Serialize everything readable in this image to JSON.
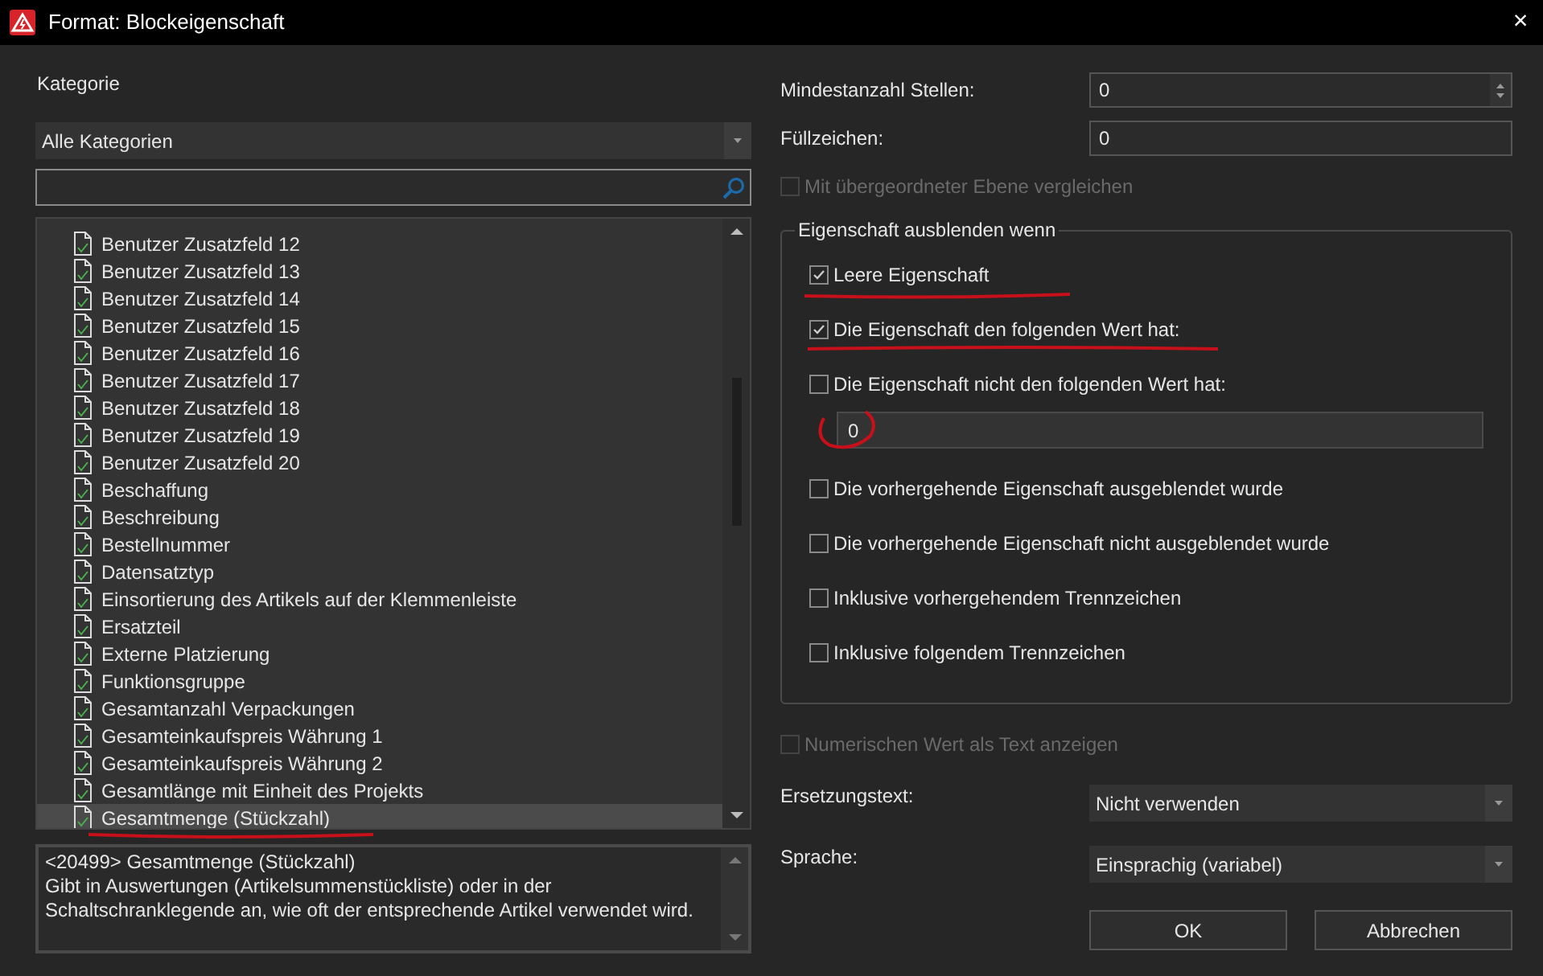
{
  "window": {
    "title": "Format: Blockeigenschaft",
    "close": "×"
  },
  "category": {
    "label": "Kategorie",
    "dropdown": "Alle Kategorien"
  },
  "properties": [
    {
      "label": "Benutzer Zusatzfeld 12",
      "selected": false
    },
    {
      "label": "Benutzer Zusatzfeld 13",
      "selected": false
    },
    {
      "label": "Benutzer Zusatzfeld 14",
      "selected": false
    },
    {
      "label": "Benutzer Zusatzfeld 15",
      "selected": false
    },
    {
      "label": "Benutzer Zusatzfeld 16",
      "selected": false
    },
    {
      "label": "Benutzer Zusatzfeld 17",
      "selected": false
    },
    {
      "label": "Benutzer Zusatzfeld 18",
      "selected": false
    },
    {
      "label": "Benutzer Zusatzfeld 19",
      "selected": false
    },
    {
      "label": "Benutzer Zusatzfeld 20",
      "selected": false
    },
    {
      "label": "Beschaffung",
      "selected": false
    },
    {
      "label": "Beschreibung",
      "selected": false
    },
    {
      "label": "Bestellnummer",
      "selected": false
    },
    {
      "label": "Datensatztyp",
      "selected": false
    },
    {
      "label": "Einsortierung des Artikels auf der Klemmenleiste",
      "selected": false
    },
    {
      "label": "Ersatzteil",
      "selected": false
    },
    {
      "label": "Externe Platzierung",
      "selected": false
    },
    {
      "label": "Funktionsgruppe",
      "selected": false
    },
    {
      "label": "Gesamtanzahl Verpackungen",
      "selected": false
    },
    {
      "label": "Gesamteinkaufspreis Währung 1",
      "selected": false
    },
    {
      "label": "Gesamteinkaufspreis Währung 2",
      "selected": false
    },
    {
      "label": "Gesamtlänge mit Einheit des Projekts",
      "selected": false
    },
    {
      "label": "Gesamtmenge (Stückzahl)",
      "selected": true
    }
  ],
  "description": [
    "<20499>  Gesamtmenge (Stückzahl)",
    "Gibt in Auswertungen (Artikelsummenstückliste) oder in der Schaltschranklegende an, wie oft der entsprechende Artikel verwendet wird."
  ],
  "min_digits": {
    "label": "Mindestanzahl Stellen:",
    "value": "0"
  },
  "fill_char": {
    "label": "Füllzeichen:",
    "value": "0"
  },
  "compare_parent": {
    "label": "Mit übergeordneter Ebene vergleichen",
    "checked": false,
    "disabled": true
  },
  "hide_group": {
    "title": "Eigenschaft ausblenden wenn",
    "items": [
      {
        "kind": "checkbox",
        "label": "Leere Eigenschaft",
        "checked": true
      },
      {
        "kind": "checkbox",
        "label": "Die Eigenschaft den folgenden Wert hat:",
        "checked": true
      },
      {
        "kind": "checkbox",
        "label": "Die Eigenschaft nicht den folgenden Wert hat:",
        "checked": false
      },
      {
        "kind": "field",
        "value": "0"
      },
      {
        "kind": "checkbox",
        "label": "Die vorhergehende Eigenschaft ausgeblendet wurde",
        "checked": false
      },
      {
        "kind": "checkbox",
        "label": "Die vorhergehende Eigenschaft nicht ausgeblendet wurde",
        "checked": false
      },
      {
        "kind": "checkbox",
        "label": "Inklusive vorhergehendem Trennzeichen",
        "checked": false
      },
      {
        "kind": "checkbox",
        "label": "Inklusive folgendem Trennzeichen",
        "checked": false
      }
    ]
  },
  "numeric_as_text": {
    "label": "Numerischen Wert als Text anzeigen",
    "checked": false,
    "disabled": true
  },
  "replacement_text": {
    "label": "Ersetzungstext:",
    "value": "Nicht verwenden"
  },
  "language": {
    "label": "Sprache:",
    "value": "Einsprachig (variabel)"
  },
  "buttons": [
    "OK",
    "Abbrechen"
  ]
}
